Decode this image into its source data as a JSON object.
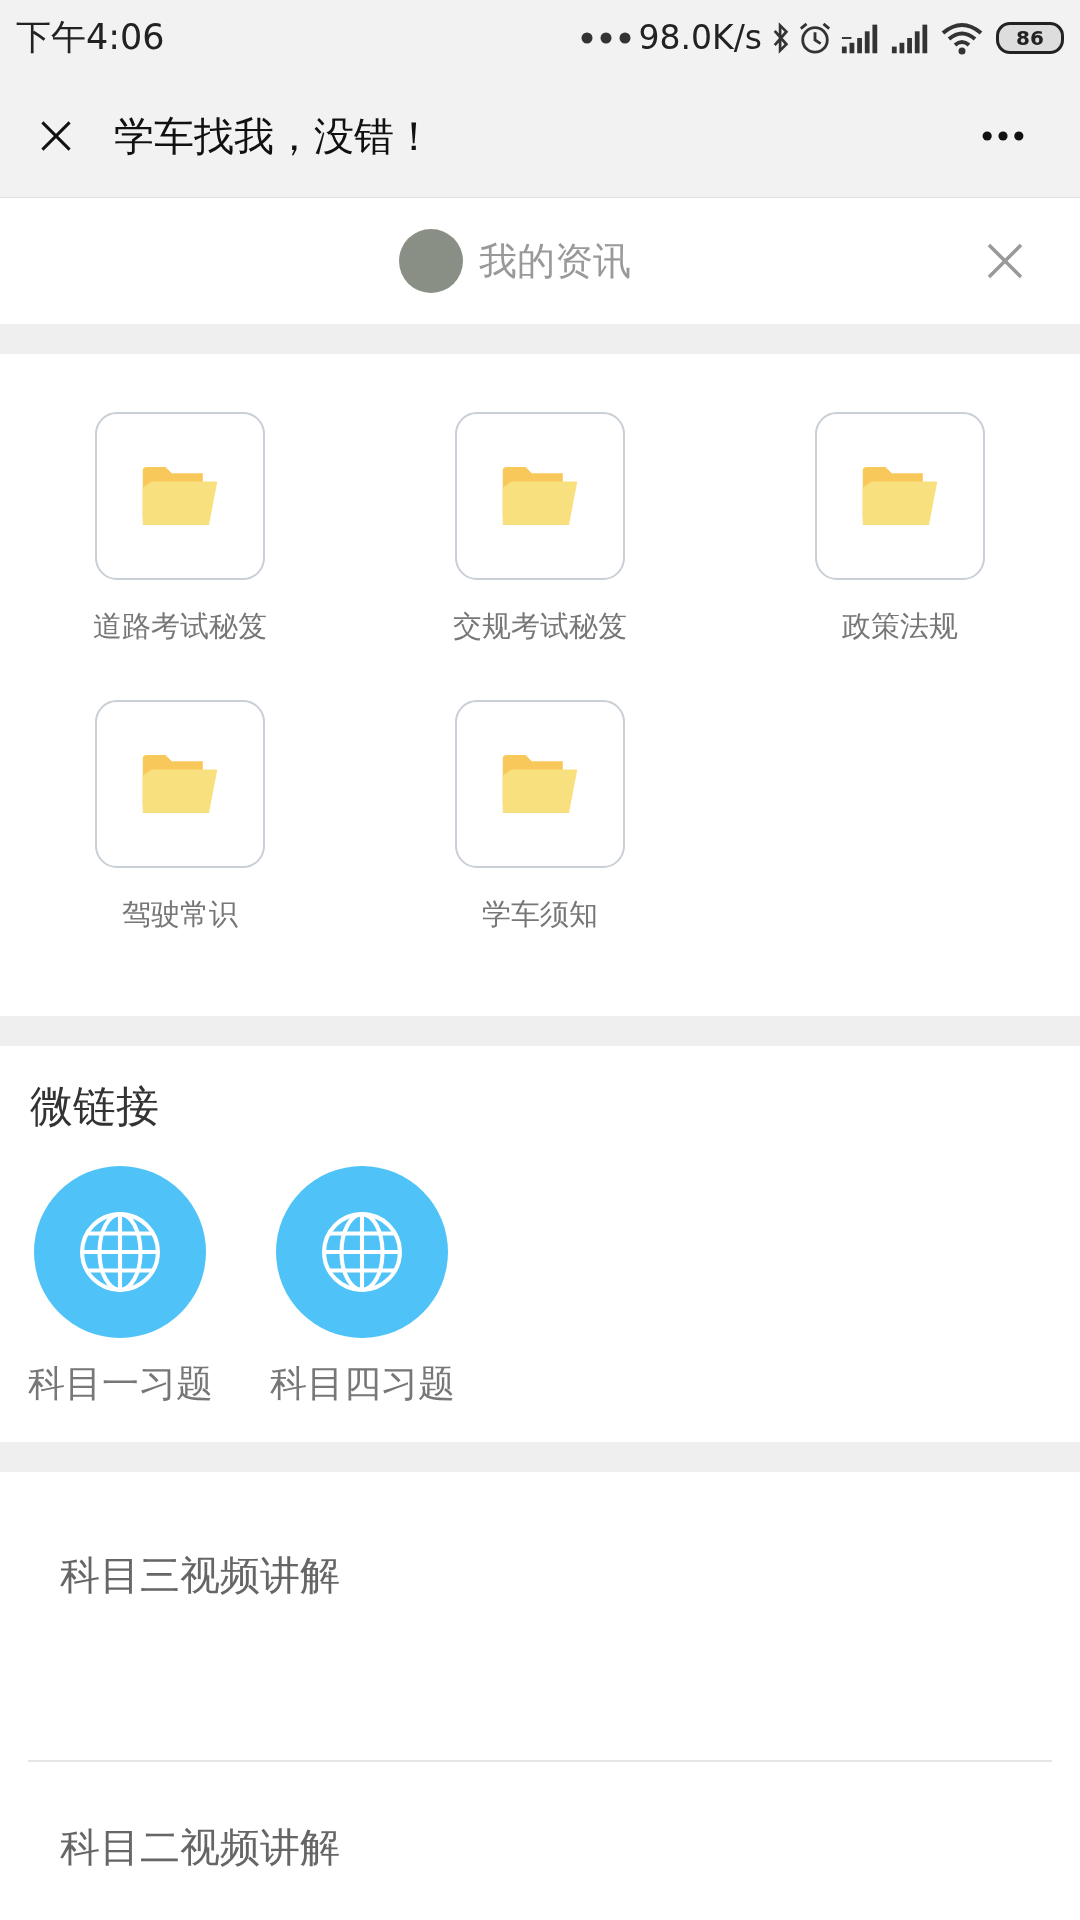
{
  "status_bar": {
    "time": "下午4:06",
    "net_speed": "98.0K/s",
    "battery": "86"
  },
  "title_bar": {
    "title": "学车找我，没错！"
  },
  "account_bar": {
    "name": "我的资讯"
  },
  "folders": [
    {
      "label": "道路考试秘笈"
    },
    {
      "label": "交规考试秘笈"
    },
    {
      "label": "政策法规"
    },
    {
      "label": "驾驶常识"
    },
    {
      "label": "学车须知"
    }
  ],
  "micro_links": {
    "title": "微链接",
    "items": [
      {
        "label": "科目一习题"
      },
      {
        "label": "科目四习题"
      }
    ]
  },
  "articles": [
    {
      "title": "科目三视频讲解"
    },
    {
      "title": "科目二视频讲解"
    }
  ]
}
